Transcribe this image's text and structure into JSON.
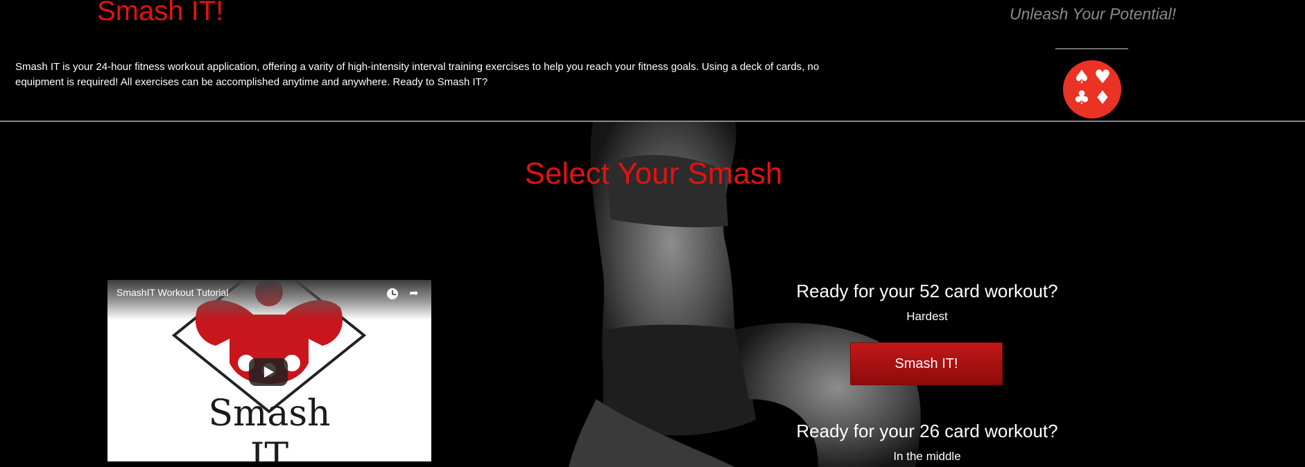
{
  "header": {
    "brand": "Smash IT!",
    "tagline": "Unleash Your Potential!",
    "intro": "Smash IT is your 24-hour fitness workout application, offering a varity of high-intensity interval training exercises to help you reach your fitness goals. Using a deck of cards, no equipment is required! All exercises can be accomplished anytime and anywhere. Ready to Smash IT?",
    "logo_suits": [
      "♠",
      "♥",
      "♣",
      "♦"
    ]
  },
  "main": {
    "title": "Select Your Smash",
    "video": {
      "title": "SmashIT Workout Tutorial",
      "thumbnail_text": "Smash\nIT"
    },
    "options": [
      {
        "heading": "Ready for your 52 card workout?",
        "difficulty": "Hardest",
        "button": "Smash IT!"
      },
      {
        "heading": "Ready for your 26 card workout?",
        "difficulty": "In the middle"
      }
    ]
  },
  "colors": {
    "brand_red": "#e31212",
    "logo_red": "#ea3324",
    "background": "#000000"
  },
  "icons": [
    "watch-later-icon",
    "share-icon",
    "play-icon",
    "card-suits-logo"
  ]
}
